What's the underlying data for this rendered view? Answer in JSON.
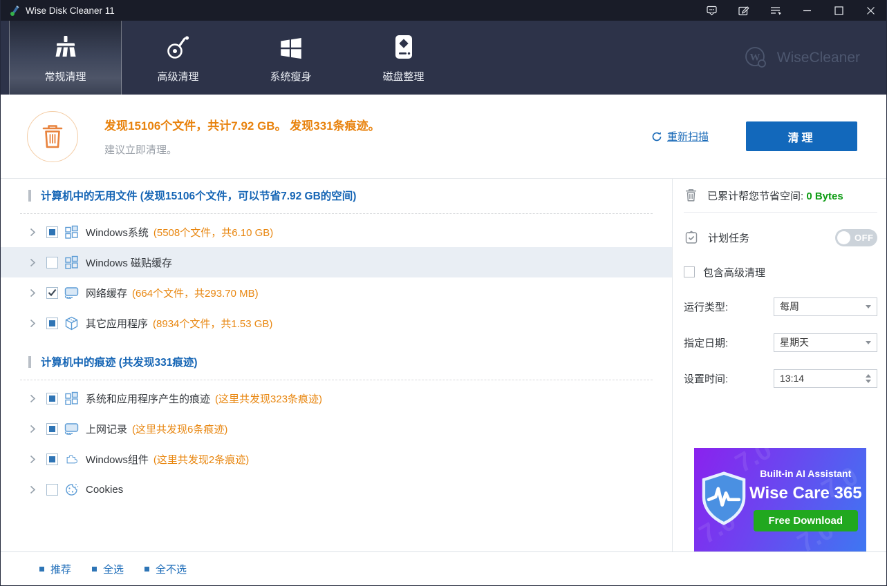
{
  "window": {
    "title": "Wise Disk Cleaner 11"
  },
  "nav": {
    "tabs": [
      {
        "label": "常规清理",
        "icon": "broom-icon",
        "active": true
      },
      {
        "label": "高级清理",
        "icon": "vacuum-icon",
        "active": false
      },
      {
        "label": "系统瘦身",
        "icon": "windows-logo-icon",
        "active": false
      },
      {
        "label": "磁盘整理",
        "icon": "disk-icon",
        "active": false
      }
    ],
    "brand": "WiseCleaner"
  },
  "summary": {
    "headline": "发现15106个文件，共计7.92 GB。 发现331条痕迹。",
    "suggestion": "建议立即清理。",
    "rescan_label": "重新扫描",
    "clean_label": "清理"
  },
  "sections": [
    {
      "title": "计算机中的无用文件 (发现15106个文件，可以节省7.92 GB的空间)",
      "rows": [
        {
          "label": "Windows系统",
          "detail": "(5508个文件，共6.10 GB)",
          "state": "partial",
          "icon": "windows-tiles-icon",
          "selected": false
        },
        {
          "label": "Windows 磁贴缓存",
          "detail": "",
          "state": "unchecked",
          "icon": "windows-tiles-icon",
          "selected": true
        },
        {
          "label": "网络缓存",
          "detail": "(664个文件，共293.70 MB)",
          "state": "checked",
          "icon": "browser-cache-icon",
          "selected": false
        },
        {
          "label": "其它应用程序",
          "detail": "(8934个文件，共1.53 GB)",
          "state": "partial",
          "icon": "app-box-icon",
          "selected": false
        }
      ]
    },
    {
      "title": "计算机中的痕迹 (共发现331痕迹)",
      "rows": [
        {
          "label": "系统和应用程序产生的痕迹",
          "detail": "(这里共发现323条痕迹)",
          "state": "partial",
          "icon": "windows-tiles-icon",
          "selected": false
        },
        {
          "label": "上网记录",
          "detail": "(这里共发现6条痕迹)",
          "state": "partial",
          "icon": "browser-cache-icon",
          "selected": false
        },
        {
          "label": "Windows组件",
          "detail": "(这里共发现2条痕迹)",
          "state": "partial",
          "icon": "puzzle-icon",
          "selected": false
        },
        {
          "label": "Cookies",
          "detail": "",
          "state": "unchecked",
          "icon": "cookie-icon",
          "selected": false
        }
      ]
    }
  ],
  "sidebar": {
    "saved_label": "已累计帮您节省空间:",
    "saved_value": "0 Bytes",
    "schedule_label": "计划任务",
    "schedule_toggle": "OFF",
    "include_advanced_label": "包含高级清理",
    "fields": [
      {
        "label": "运行类型:",
        "value": "每周",
        "control": "select",
        "name": "run-type-select"
      },
      {
        "label": "指定日期:",
        "value": "星期天",
        "control": "select",
        "name": "day-select"
      },
      {
        "label": "设置时间:",
        "value": "13:14",
        "control": "spinner",
        "name": "time-spinner"
      }
    ]
  },
  "ad": {
    "tagline": "Built-in AI Assistant",
    "product": "Wise Care 365",
    "button": "Free Download",
    "watermark": "7.0"
  },
  "footer": {
    "links": [
      "推荐",
      "全选",
      "全不选"
    ]
  },
  "colors": {
    "accent_blue": "#1268bb",
    "link_blue": "#1b6bb8",
    "orange": "#e8820d",
    "green": "#0e9c14",
    "titlebar_bg": "#191c28",
    "nav_bg": "#2d3349",
    "selected_row_bg": "#e9eef4",
    "ad_gradient": [
      "#8a22ee",
      "#3e77f2"
    ]
  }
}
